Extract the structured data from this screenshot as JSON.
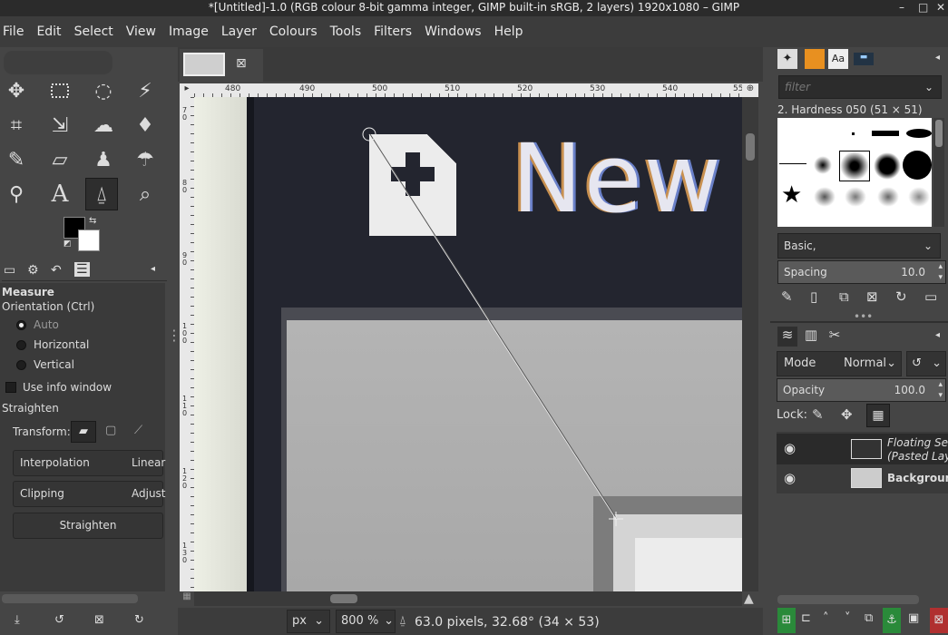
{
  "window": {
    "title": "*[Untitled]-1.0 (RGB colour 8-bit gamma integer, GIMP built-in sRGB, 2 layers) 1920x1080 – GIMP"
  },
  "menu": [
    "File",
    "Edit",
    "Select",
    "View",
    "Image",
    "Layer",
    "Colours",
    "Tools",
    "Filters",
    "Windows",
    "Help"
  ],
  "tools": [
    "move-icon",
    "rect-select-icon",
    "lasso-icon",
    "fuzzy-select-icon",
    "crop-icon",
    "transform-icon",
    "warp-icon",
    "bucket-icon",
    "paintbrush-icon",
    "eraser-icon",
    "clone-icon",
    "smudge-icon",
    "paths-icon",
    "text-icon",
    "measure-icon",
    "zoom-icon"
  ],
  "tool_options": {
    "title": "Measure",
    "orientation_label": "Orientation  (Ctrl)",
    "orientation_options": [
      "Auto",
      "Horizontal",
      "Vertical"
    ],
    "use_info_window": "Use info window",
    "straighten_section": "Straighten",
    "transform_label": "Transform:",
    "interpolation_label": "Interpolation",
    "interpolation_value": "Linear",
    "clipping_label": "Clipping",
    "clipping_value": "Adjust",
    "straighten_button": "Straighten"
  },
  "ruler": {
    "top": [
      "480",
      "490",
      "500",
      "510",
      "520",
      "530",
      "540",
      "55"
    ],
    "left": [
      "7",
      "0",
      "8",
      "0",
      "9",
      "0",
      "1",
      "0",
      "0",
      "1",
      "1",
      "0",
      "1",
      "2",
      "0",
      "1",
      "3",
      "0"
    ]
  },
  "canvas": {
    "new_text": "New"
  },
  "statusbar": {
    "unit": "px",
    "zoom": "800 %",
    "info": "63.0 pixels, 32.68° (34 × 53)"
  },
  "brushes": {
    "filter_placeholder": "filter",
    "selected": "2. Hardness 050 (51 × 51)",
    "preset": "Basic,",
    "spacing_label": "Spacing",
    "spacing_value": "10.0"
  },
  "layers": {
    "mode_label": "Mode",
    "mode_value": "Normal",
    "opacity_label": "Opacity",
    "opacity_value": "100.0",
    "lock_label": "Lock:",
    "items": [
      {
        "name": "Floating Sele",
        "sub": "(Pasted Laye"
      },
      {
        "name": "Background",
        "sub": ""
      }
    ]
  }
}
